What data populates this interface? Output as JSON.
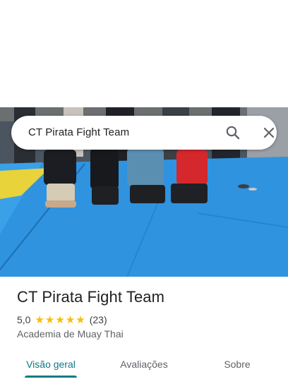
{
  "search": {
    "query": "CT Pirata Fight Team",
    "search_icon": "search-icon",
    "close_icon": "close-icon"
  },
  "place": {
    "name": "CT Pirata Fight Team",
    "rating": "5,0",
    "stars": 5,
    "star_glyph": "★",
    "reviews": "(23)",
    "category": "Academia de Muay Thai"
  },
  "tabs": [
    {
      "label": "Visão geral",
      "active": true
    },
    {
      "label": "Avaliações",
      "active": false
    },
    {
      "label": "Sobre",
      "active": false
    }
  ],
  "colors": {
    "accent": "#0d7a85",
    "star": "#fbbc04",
    "mat": "#2f93df"
  }
}
